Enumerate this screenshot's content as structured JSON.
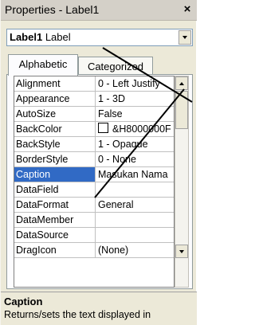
{
  "window": {
    "title": "Properties - Label1",
    "close_glyph": "×"
  },
  "object_combo": {
    "name": "Label1",
    "type": "Label"
  },
  "tabs": [
    {
      "label": "Alphabetic",
      "active": true
    },
    {
      "label": "Categorized",
      "active": false
    }
  ],
  "properties": [
    {
      "name": "Alignment",
      "value": "0 - Left Justify"
    },
    {
      "name": "Appearance",
      "value": "1 - 3D"
    },
    {
      "name": "AutoSize",
      "value": "False"
    },
    {
      "name": "BackColor",
      "value": "&H8000000F"
    },
    {
      "name": "BackStyle",
      "value": "1 - Opaque"
    },
    {
      "name": "BorderStyle",
      "value": "0 - None"
    },
    {
      "name": "Caption",
      "value": "Masukan Nama"
    },
    {
      "name": "DataField",
      "value": ""
    },
    {
      "name": "DataFormat",
      "value": "General"
    },
    {
      "name": "DataMember",
      "value": ""
    },
    {
      "name": "DataSource",
      "value": ""
    },
    {
      "name": "DragIcon",
      "value": "(None)"
    }
  ],
  "selected_property": "Caption",
  "description": {
    "title": "Caption",
    "text": "Returns/sets the text displayed in"
  },
  "colors": {
    "selection": "#316ac5",
    "swatch": "#ffffff",
    "annotation_lines": "#000000"
  },
  "icons": {
    "close": "close-icon",
    "dropdown": "chevron-down-icon",
    "scroll_up": "scroll-up-icon"
  }
}
